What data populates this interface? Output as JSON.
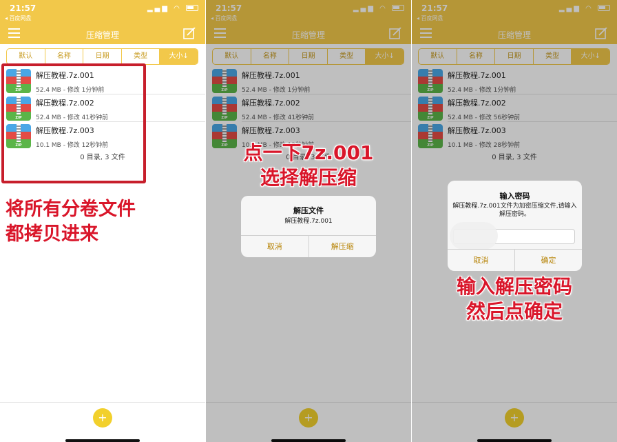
{
  "status": {
    "time": "21:57",
    "back_app": "◂ 百度网盘"
  },
  "header": {
    "title": "压缩管理"
  },
  "sort_tabs": [
    "默认",
    "名称",
    "日期",
    "类型",
    "大小↓"
  ],
  "zip_icon_text": "ZIP",
  "panels": [
    {
      "files": [
        {
          "name": "解压教程.7z.001",
          "meta": "52.4 MB - 修改 1分钟前"
        },
        {
          "name": "解压教程.7z.002",
          "meta": "52.4 MB - 修改 41秒钟前"
        },
        {
          "name": "解压教程.7z.003",
          "meta": "10.1 MB - 修改 12秒钟前"
        }
      ],
      "summary": "0 目录, 3 文件",
      "annotation": [
        "将所有分卷文件",
        "都拷贝进来"
      ]
    },
    {
      "files": [
        {
          "name": "解压教程.7z.001",
          "meta": "52.4 MB - 修改 1分钟前"
        },
        {
          "name": "解压教程.7z.002",
          "meta": "52.4 MB - 修改 41秒钟前"
        },
        {
          "name": "解压教程.7z.003",
          "meta": "10.1 MB - 修改 12秒钟前"
        }
      ],
      "summary": "0 目录, 3 文件",
      "annotation": [
        "点一下7z.001",
        "选择解压缩"
      ],
      "dialog": {
        "title": "解压文件",
        "message": "解压教程.7z.001",
        "cancel": "取消",
        "confirm": "解压缩"
      }
    },
    {
      "files": [
        {
          "name": "解压教程.7z.001",
          "meta": "52.4 MB - 修改 1分钟前"
        },
        {
          "name": "解压教程.7z.002",
          "meta": "52.4 MB - 修改 56秒钟前"
        },
        {
          "name": "解压教程.7z.003",
          "meta": "10.1 MB - 修改 28秒钟前"
        }
      ],
      "summary": "0 目录, 3 文件",
      "annotation": [
        "输入解压密码",
        "然后点确定"
      ],
      "dialog": {
        "title": "输入密码",
        "message": "解压教程.7z.001文件为加密压缩文件,请输入解压密码。",
        "cancel": "取消",
        "confirm": "确定"
      }
    }
  ],
  "fab": {
    "label": "+"
  },
  "colors": {
    "header": "#f2c84a",
    "accent": "#c79a1e",
    "annotation": "#d9162a",
    "fab": "#f2d02c"
  }
}
